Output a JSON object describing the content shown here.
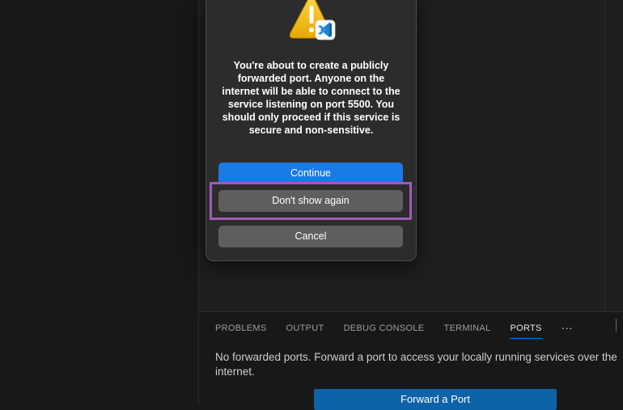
{
  "dialog": {
    "message": "You're about to create a publicly forwarded port. Anyone on the internet will be able to connect to the service listening on port 5500. You should only proceed if this service is secure and non-sensitive.",
    "continue_label": "Continue",
    "dont_show_label": "Don't show again",
    "cancel_label": "Cancel",
    "icon": "warning-icon",
    "badge_icon": "vscode-icon"
  },
  "panel": {
    "tabs": [
      {
        "label": "PROBLEMS"
      },
      {
        "label": "OUTPUT"
      },
      {
        "label": "DEBUG CONSOLE"
      },
      {
        "label": "TERMINAL"
      },
      {
        "label": "PORTS",
        "active": true
      }
    ],
    "more_label": "···",
    "ports_message": "No forwarded ports. Forward a port to access your locally running services over the internet.",
    "forward_button_label": "Forward a Port"
  },
  "colors": {
    "accent": "#0078d4",
    "primary_button": "#1a7ae6",
    "highlight": "#a259b8"
  }
}
